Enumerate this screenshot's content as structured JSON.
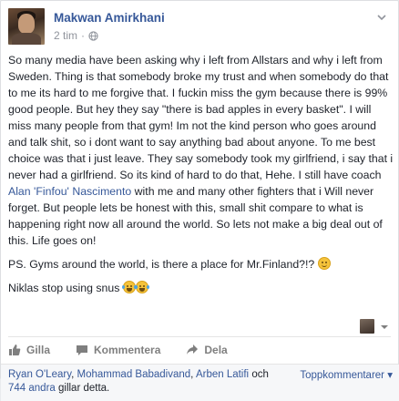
{
  "post": {
    "author": "Makwan Amirkhani",
    "time": "2 tim",
    "separator": "·",
    "paragraph1_before": "So many media have been asking why i left from Allstars and why i left from Sweden. Thing is that somebody broke my trust and when somebody do that to me its hard to me forgive that. I fuckin miss the gym because there is 99% good people. But hey they say \"there is bad apples in every basket\". I will miss many people from that gym! Im not the kind person who goes around and talk shit, so i dont want to say anything bad about anyone. To me best choice was that i just leave. They say somebody took my girlfriend, i say that i never had a girlfriend. So its kind of hard to do that, Hehe. I still have coach ",
    "mention": "Alan 'Finfou' Nascimento",
    "paragraph1_after": " with me and many other fighters that i Will never forget. But people lets be honest with this, small shit compare to what is happening right now all around the world. So lets not make a big deal out of this. Life goes on!",
    "paragraph2": "PS. Gyms around the world, is there a place for Mr.Finland?!?",
    "paragraph3": "Niklas stop using snus"
  },
  "actions": {
    "like": "Gilla",
    "comment": "Kommentera",
    "share": "Dela"
  },
  "footer": {
    "liker1": "Ryan O'Leary",
    "sep1": ", ",
    "liker2": "Mohammad Babadivand",
    "sep2": ", ",
    "liker3": "Arben Latifi",
    "and": " och",
    "others": "744 andra",
    "tail": " gillar detta.",
    "top_comments": "Toppkommentarer"
  },
  "icons": {
    "audience": "globe-icon",
    "menu": "chevron-down-icon",
    "like": "thumbs-up-icon",
    "comment": "comment-bubble-icon",
    "share": "share-arrow-icon"
  },
  "colors": {
    "link": "#365899",
    "text": "#1d2129",
    "muted": "#90949c"
  }
}
